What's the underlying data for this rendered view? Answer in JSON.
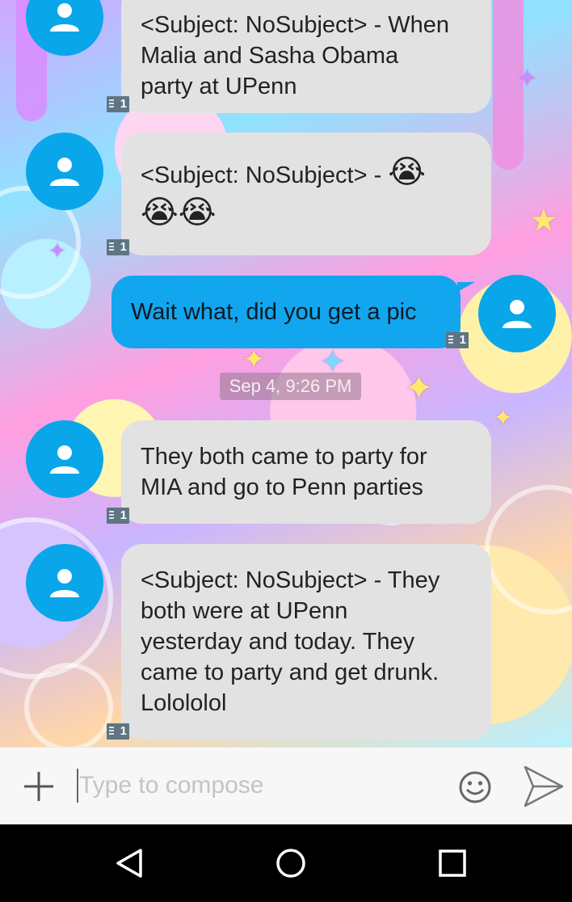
{
  "conversation": {
    "messages": [
      {
        "direction": "incoming",
        "text": "<Subject: NoSubject> - When\nMalia and Sasha Obama\nparty at UPenn",
        "sim": "1"
      },
      {
        "direction": "incoming",
        "text": "<Subject: NoSubject> - ",
        "emoji_1": "😭",
        "emoji_2": "😭😭",
        "sim": "1"
      },
      {
        "direction": "outgoing",
        "text": "Wait what, did you get a pic",
        "sim": "1"
      },
      {
        "direction": "incoming",
        "text": "They both came to party for\nMIA and go to Penn parties",
        "sim": "1"
      },
      {
        "direction": "incoming",
        "text": "<Subject: NoSubject> - They\nboth were at UPenn\nyesterday and today. They\ncame to party and get drunk.\nLolololol",
        "sim": "1"
      }
    ],
    "timestamp": "Sep 4, 9:26 PM"
  },
  "compose": {
    "placeholder": "Type to compose",
    "value": "",
    "add_icon": "plus-icon",
    "emoji_icon": "smiley-icon",
    "send_icon": "send-icon"
  },
  "navbar": {
    "back_icon": "back-triangle-icon",
    "home_icon": "home-circle-icon",
    "recents_icon": "recents-square-icon"
  },
  "colors": {
    "avatar": "#0aa6ea",
    "incoming_bubble": "#e2e2e2",
    "outgoing_bubble": "#12a6ee",
    "compose_bg": "#f7f7f7"
  }
}
